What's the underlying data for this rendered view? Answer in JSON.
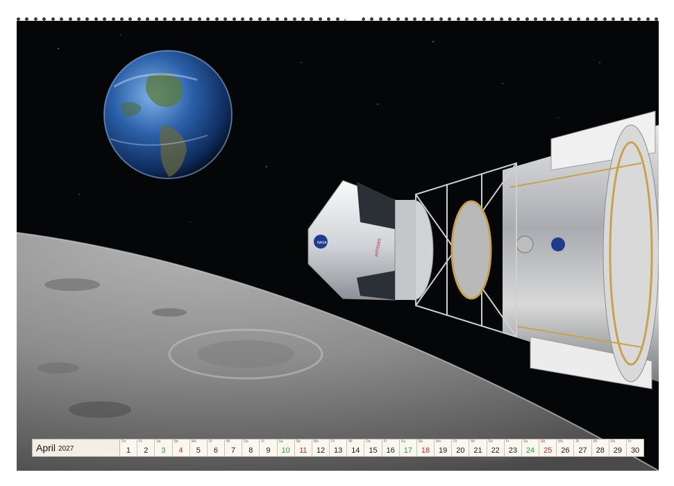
{
  "calendar": {
    "month": "April",
    "year": "2027",
    "days": [
      {
        "wd": "Do",
        "n": "1",
        "kind": "weekday"
      },
      {
        "wd": "Fr",
        "n": "2",
        "kind": "weekday"
      },
      {
        "wd": "Sa",
        "n": "3",
        "kind": "sat"
      },
      {
        "wd": "So",
        "n": "4",
        "kind": "sun"
      },
      {
        "wd": "Mo",
        "n": "5",
        "kind": "weekday"
      },
      {
        "wd": "Di",
        "n": "6",
        "kind": "weekday"
      },
      {
        "wd": "Mi",
        "n": "7",
        "kind": "weekday"
      },
      {
        "wd": "Do",
        "n": "8",
        "kind": "weekday"
      },
      {
        "wd": "Fr",
        "n": "9",
        "kind": "weekday"
      },
      {
        "wd": "Sa",
        "n": "10",
        "kind": "sat"
      },
      {
        "wd": "So",
        "n": "11",
        "kind": "sun"
      },
      {
        "wd": "Mo",
        "n": "12",
        "kind": "weekday"
      },
      {
        "wd": "Di",
        "n": "13",
        "kind": "weekday"
      },
      {
        "wd": "Mi",
        "n": "14",
        "kind": "weekday"
      },
      {
        "wd": "Do",
        "n": "15",
        "kind": "weekday"
      },
      {
        "wd": "Fr",
        "n": "16",
        "kind": "weekday"
      },
      {
        "wd": "Sa",
        "n": "17",
        "kind": "sat"
      },
      {
        "wd": "So",
        "n": "18",
        "kind": "sun"
      },
      {
        "wd": "Mo",
        "n": "19",
        "kind": "weekday"
      },
      {
        "wd": "Di",
        "n": "20",
        "kind": "weekday"
      },
      {
        "wd": "Mi",
        "n": "21",
        "kind": "weekday"
      },
      {
        "wd": "Do",
        "n": "22",
        "kind": "weekday"
      },
      {
        "wd": "Fr",
        "n": "23",
        "kind": "weekday"
      },
      {
        "wd": "Sa",
        "n": "24",
        "kind": "sat"
      },
      {
        "wd": "So",
        "n": "25",
        "kind": "sun"
      },
      {
        "wd": "Mo",
        "n": "26",
        "kind": "weekday"
      },
      {
        "wd": "Di",
        "n": "27",
        "kind": "weekday"
      },
      {
        "wd": "Mi",
        "n": "28",
        "kind": "weekday"
      },
      {
        "wd": "Do",
        "n": "29",
        "kind": "weekday"
      },
      {
        "wd": "Fr",
        "n": "30",
        "kind": "weekday"
      }
    ]
  },
  "photo": {
    "subjects": [
      "earth-icon",
      "moon-surface",
      "spacecraft-icon"
    ],
    "spacecraft_labels": {
      "agency": "NASA",
      "name": "ARTEMIS"
    },
    "colors": {
      "space": "#050608",
      "ocean": "#2a5fa8",
      "moon": "#8d8d8d",
      "hull": "#e8e8e8",
      "gold": "#c8a24a"
    }
  }
}
